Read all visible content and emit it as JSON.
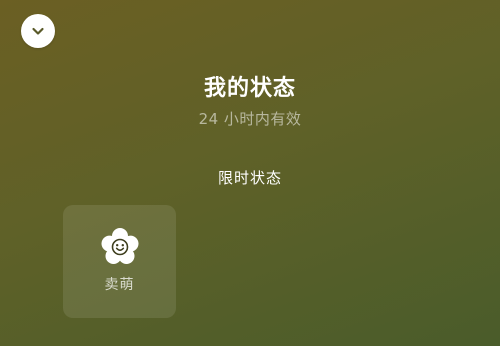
{
  "header": {
    "title": "我的状态",
    "subtitle": "24 小时内有效"
  },
  "section": {
    "title": "限时状态"
  },
  "statuses": [
    {
      "label": "卖萌",
      "icon": "smiling-flower-icon"
    }
  ],
  "icons": {
    "collapse": "chevron-down-icon"
  },
  "colors": {
    "background_start": "#6b5f23",
    "background_end": "#4a5c2a",
    "text": "#ffffff"
  }
}
